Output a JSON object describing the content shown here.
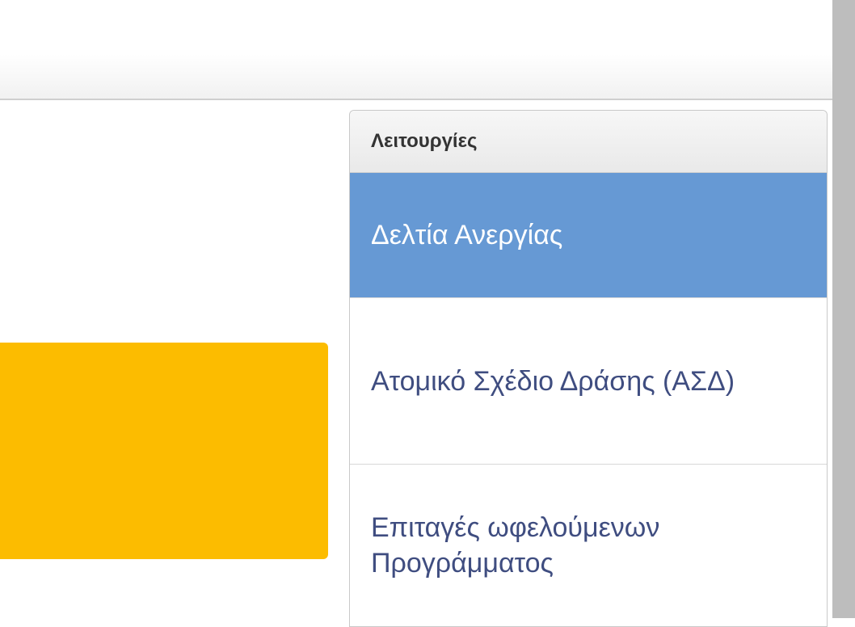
{
  "functions_panel": {
    "title": "Λειτουργίες",
    "items": [
      {
        "label": "Δελτία Ανεργίας",
        "active": true
      },
      {
        "label": "Ατομικό Σχέδιο Δράσης (ΑΣΔ)",
        "active": false
      },
      {
        "label": "Επιταγές ωφελούμενων Προγράμματος",
        "active": false
      }
    ]
  },
  "colors": {
    "active_item_bg": "#6699d4",
    "link_text": "#3f4d80",
    "yellow_panel": "#fcbc00"
  }
}
